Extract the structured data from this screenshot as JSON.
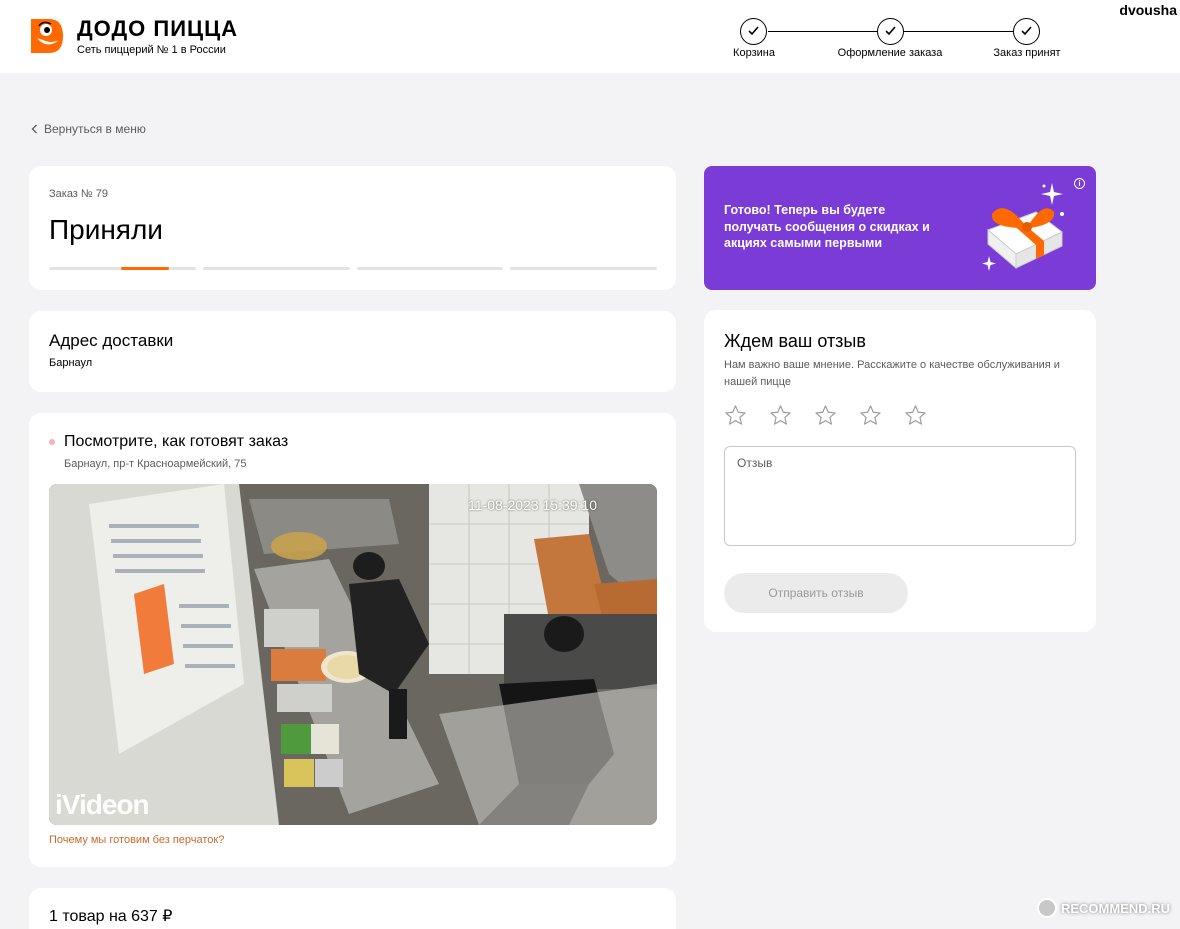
{
  "header": {
    "brand_title": "ДОДО ПИЦЦА",
    "brand_subtitle": "Сеть пиццерий № 1 в России",
    "username": "dvousha",
    "steps": [
      {
        "label": "Корзина",
        "done": true
      },
      {
        "label": "Оформление заказа",
        "done": true
      },
      {
        "label": "Заказ принят",
        "done": true
      }
    ]
  },
  "back_link": "Вернуться в меню",
  "order": {
    "number_label": "Заказ № 79",
    "status": "Приняли",
    "progress_segments": 4,
    "active_segment": 1
  },
  "address": {
    "title": "Адрес доставки",
    "value": "Барнаул"
  },
  "camera": {
    "title": "Посмотрите, как готовят заказ",
    "address": "Барнаул, пр-т Красноармейский, 75",
    "timestamp": "11-08-2023 15:39:10",
    "watermark": "iVideon",
    "gloves_link": "Почему мы готовим без перчаток?"
  },
  "items": {
    "summary": "1 товар на 637 ₽"
  },
  "promo": {
    "text": "Готово! Теперь вы будете получать сообщения о скидках и акциях самыми первыми",
    "info_icon": "i",
    "background": "#7b3bd6"
  },
  "review": {
    "title": "Ждем ваш отзыв",
    "description": "Нам важно ваше мнение. Расскажите о качестве обслуживания и нашей пицце",
    "stars": 5,
    "input_placeholder": "Отзыв",
    "input_value": "",
    "send_label": "Отправить отзыв"
  },
  "watermark_site": "RECOMMEND.RU",
  "colors": {
    "accent": "#ff6900",
    "link": "#cb6a2a",
    "page_bg": "#f3f2f5"
  }
}
